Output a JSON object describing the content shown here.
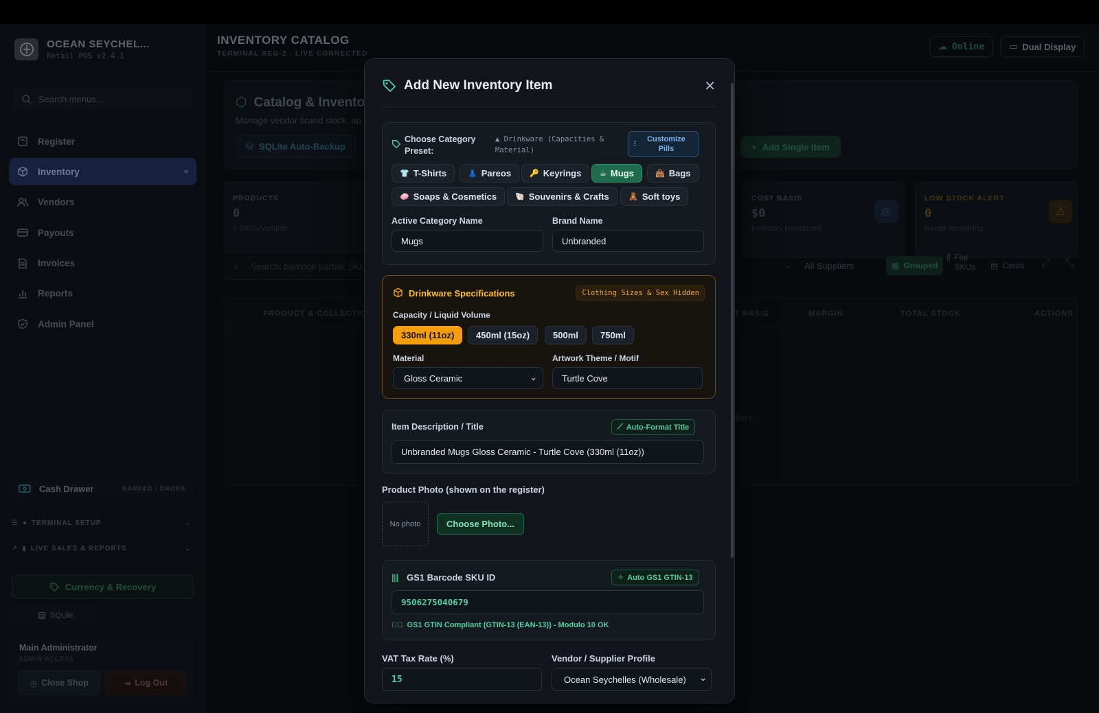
{
  "sidebar": {
    "brand_title": "OCEAN SEYCHEL...",
    "brand_sub": "Retail POS v2.4.1",
    "search_placeholder": "Search menus...",
    "nav": [
      {
        "label": "Register",
        "icon": "register-icon"
      },
      {
        "label": "Inventory",
        "icon": "box-icon",
        "active": true
      },
      {
        "label": "Vendors",
        "icon": "users-icon"
      },
      {
        "label": "Payouts",
        "icon": "card-icon"
      },
      {
        "label": "Invoices",
        "icon": "document-icon"
      },
      {
        "label": "Reports",
        "icon": "bar-chart-icon"
      },
      {
        "label": "Admin Panel",
        "icon": "shield-icon"
      }
    ],
    "cash_drawer": "Cash Drawer",
    "cash_tag": "BANKED / DROPS",
    "section_terminal": "TERMINAL SETUP",
    "section_live": "LIVE SALES & REPORTS",
    "currency": "Currency & Recovery",
    "sqlite": "SQLite",
    "admin_name": "Main Administrator",
    "admin_role": "ADMIN ACCESS",
    "close_shop": "Close Shop",
    "log_out": "Log Out"
  },
  "header": {
    "title": "INVENTORY CATALOG",
    "subtitle": "TERMINAL REG-2 · LIVE CONNECTED",
    "online": "Online",
    "dual_display": "Dual Display"
  },
  "background": {
    "catalog_title": "Catalog & Invento",
    "catalog_sub": "Manage vendor brand stock, ap",
    "sqlite_backup": "SQLite Auto-Backup",
    "add_single": "Add Single Item",
    "products_label": "PRODUCTS",
    "products_value": "0",
    "products_sub": "0 SKUs/Variants",
    "cost_label": "COST BASIS",
    "cost_value": "$0",
    "cost_sub": "Inventory investment",
    "low_label": "LOW STOCK ALERT",
    "low_value": "0",
    "low_sub": "Needs reordering",
    "search_placeholder": "Search: barcode partial, SKU",
    "all_suppliers": "All Suppliers",
    "grouped": "Grouped",
    "flat_skus": "Flat SKUs",
    "cards": "Cards",
    "col_product": "PRODUCT & COLLECTION",
    "col_cost": "ST BASIS",
    "col_margin": "MARGIN",
    "col_total": "TOTAL STOCK",
    "col_actions": "ACTIONS",
    "empty_fragment": "ilters."
  },
  "modal": {
    "title": "Add New Inventory Item",
    "preset_label": "Choose Category Preset:",
    "preset_current": "Drinkware (Capacities & Material)",
    "customize": "Customize Pills",
    "presets": [
      {
        "label": "T-Shirts",
        "glyph": "👕"
      },
      {
        "label": "Pareos",
        "glyph": "👗"
      },
      {
        "label": "Keyrings",
        "glyph": "🔑"
      },
      {
        "label": "Mugs",
        "glyph": "☕",
        "selected": true
      },
      {
        "label": "Bags",
        "glyph": "👜"
      },
      {
        "label": "Soaps & Cosmetics",
        "glyph": "🧼"
      },
      {
        "label": "Souvenirs & Crafts",
        "glyph": "🐚"
      },
      {
        "label": "Soft toys",
        "glyph": "🧸"
      }
    ],
    "active_category_label": "Active Category Name",
    "active_category_value": "Mugs",
    "brand_label": "Brand Name",
    "brand_value": "Unbranded",
    "spec_title": "Drinkware Specifications",
    "spec_badge": "Clothing Sizes & Sex Hidden",
    "capacity_label": "Capacity / Liquid Volume",
    "capacities": [
      "330ml (11oz)",
      "450ml (15oz)",
      "500ml",
      "750ml"
    ],
    "material_label": "Material",
    "material_value": "Gloss Ceramic",
    "artwork_label": "Artwork Theme / Motif",
    "artwork_value": "Turtle Cove",
    "desc_label": "Item Description / Title",
    "auto_format": "Auto-Format Title",
    "desc_value": "Unbranded Mugs Gloss Ceramic - Turtle Cove (330ml (11oz))",
    "photo_label": "Product Photo (shown on the register)",
    "no_photo": "No photo",
    "choose_photo": "Choose Photo...",
    "barcode_label": "GS1 Barcode SKU ID",
    "auto_gs1": "Auto GS1 GTIN-13",
    "barcode_value": "9506275040679",
    "barcode_ok": "GS1 GTIN Compliant (GTIN-13 (EAN-13)) - Modulo 10 OK",
    "vat_label": "VAT Tax Rate (%)",
    "vat_value": "15",
    "vendor_label": "Vendor / Supplier Profile",
    "vendor_value": "Ocean Seychelles (Wholesale)"
  },
  "colors": {
    "accent_green": "#4fd1a1",
    "accent_amber": "#f59e0b",
    "active_nav": "#1c2d52"
  }
}
